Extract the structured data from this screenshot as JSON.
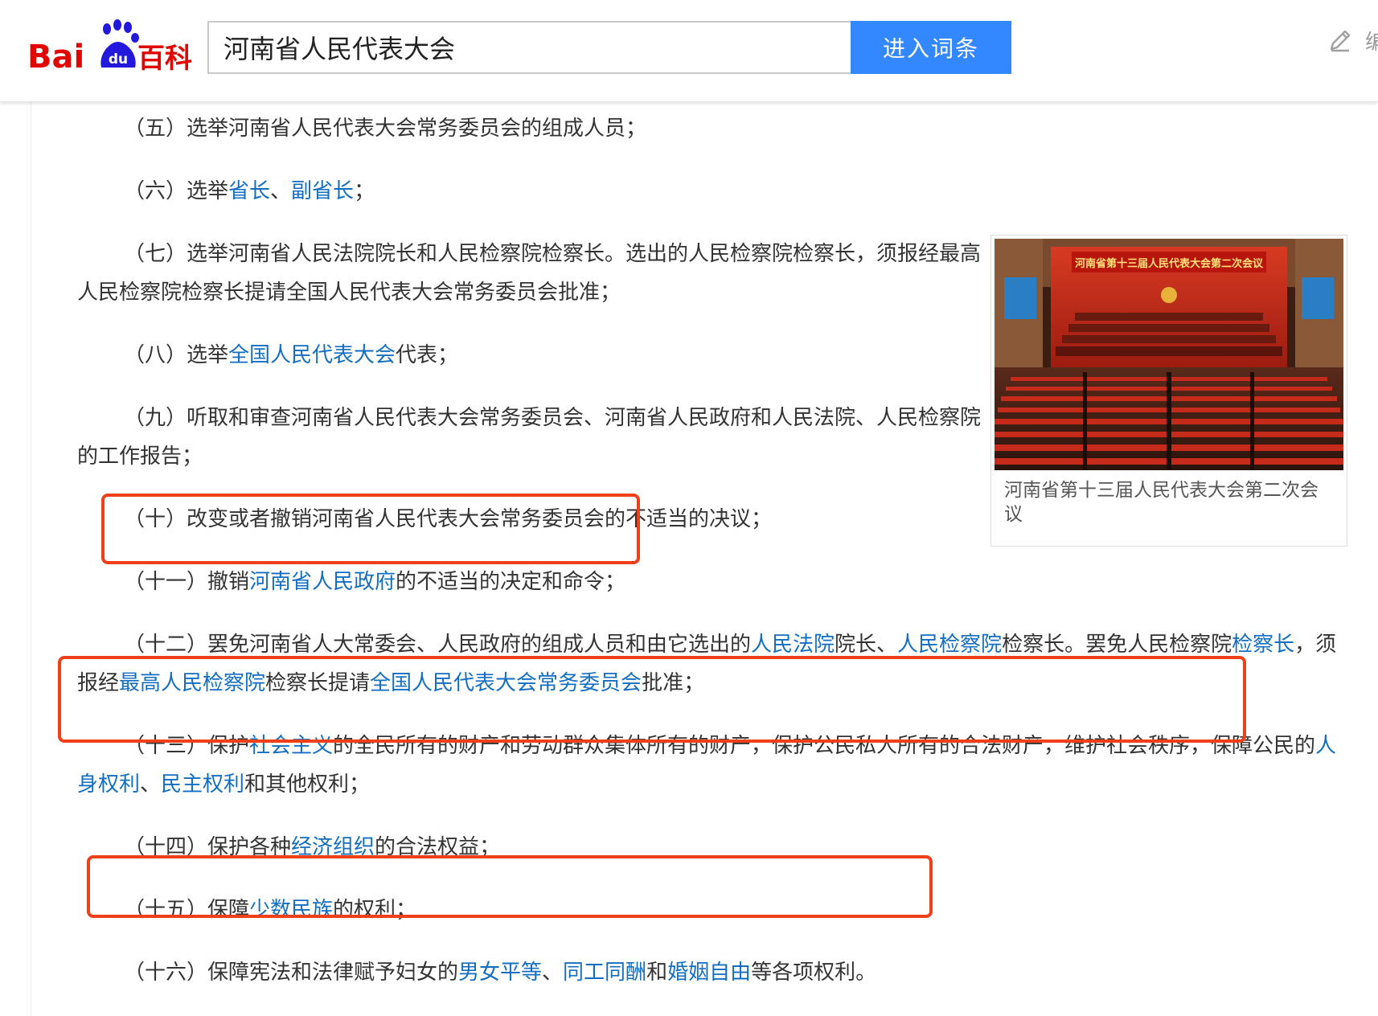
{
  "header": {
    "logo_text": "Baidu百科",
    "search": {
      "value": "河南省人民代表大会",
      "button_label": "进入词条"
    },
    "edit_label": "编"
  },
  "image": {
    "banner_text": "河南省第十三届人民代表大会第二次会议",
    "caption": "河南省第十三届人民代表大会第二次会议"
  },
  "paragraphs": [
    {
      "segments": [
        {
          "t": "（五）选举河南省人民代表大会常务委员会的组成人员；"
        }
      ]
    },
    {
      "segments": [
        {
          "t": "（六）选举"
        },
        {
          "t": "省长",
          "link": true
        },
        {
          "t": "、"
        },
        {
          "t": "副省长",
          "link": true
        },
        {
          "t": "；"
        }
      ]
    },
    {
      "segments": [
        {
          "t": "（七）选举河南省人民法院院长和人民检察院检察长。选出的人民检察院检察长，须报经最高人民检察院检察长提请全国人民代表大会常务委员会批准；"
        }
      ]
    },
    {
      "segments": [
        {
          "t": "（八）选举"
        },
        {
          "t": "全国人民代表大会",
          "link": true
        },
        {
          "t": "代表；"
        }
      ]
    },
    {
      "segments": [
        {
          "t": "（九）听取和审查河南省人民代表大会常务委员会、河南省人民政府和人民法院、人民检察院的工作报告；"
        }
      ]
    },
    {
      "segments": [
        {
          "t": "（十）改变或者撤销河南省人民代表大会常务委员会的不适当的决议；"
        }
      ]
    },
    {
      "segments": [
        {
          "t": "（十一）撤销"
        },
        {
          "t": "河南省人民政府",
          "link": true
        },
        {
          "t": "的不适当的决定和命令；"
        }
      ]
    },
    {
      "segments": [
        {
          "t": "（十二）罢免河南省人大常委会、人民政府的组成人员和由它选出的"
        },
        {
          "t": "人民法院",
          "link": true
        },
        {
          "t": "院长、"
        },
        {
          "t": "人民检察院",
          "link": true
        },
        {
          "t": "检察长。罢免人民检察院"
        },
        {
          "t": "检察长",
          "link": true
        },
        {
          "t": "，须报经"
        },
        {
          "t": "最高人民检察院",
          "link": true
        },
        {
          "t": "检察长提请"
        },
        {
          "t": "全国人民代表大会常务委员会",
          "link": true
        },
        {
          "t": "批准；"
        }
      ]
    },
    {
      "segments": [
        {
          "t": "（十三）保护"
        },
        {
          "t": "社会主义",
          "link": true
        },
        {
          "t": "的全民所有的财产和劳动群众集体所有的财产，保护公民私人所有的合法财产，维护社会秩序，保障公民的"
        },
        {
          "t": "人身权利",
          "link": true
        },
        {
          "t": "、"
        },
        {
          "t": "民主权利",
          "link": true
        },
        {
          "t": "和其他权利；"
        }
      ]
    },
    {
      "segments": [
        {
          "t": "（十四）保护各种"
        },
        {
          "t": "经济组织",
          "link": true
        },
        {
          "t": "的合法权益；"
        }
      ]
    },
    {
      "segments": [
        {
          "t": "（十五）保障"
        },
        {
          "t": "少数民族",
          "link": true
        },
        {
          "t": "的权利；"
        }
      ]
    },
    {
      "segments": [
        {
          "t": "（十六）保障宪法和法律赋予妇女的"
        },
        {
          "t": "男女平等",
          "link": true
        },
        {
          "t": "、"
        },
        {
          "t": "同工同酬",
          "link": true
        },
        {
          "t": "和"
        },
        {
          "t": "婚姻自由",
          "link": true
        },
        {
          "t": "等各项权利。"
        }
      ]
    }
  ],
  "colors": {
    "link": "#136ec2",
    "highlight": "#f0401a",
    "search_button": "#3388ff",
    "logo_red": "#e10601",
    "logo_blue": "#2319dc"
  }
}
